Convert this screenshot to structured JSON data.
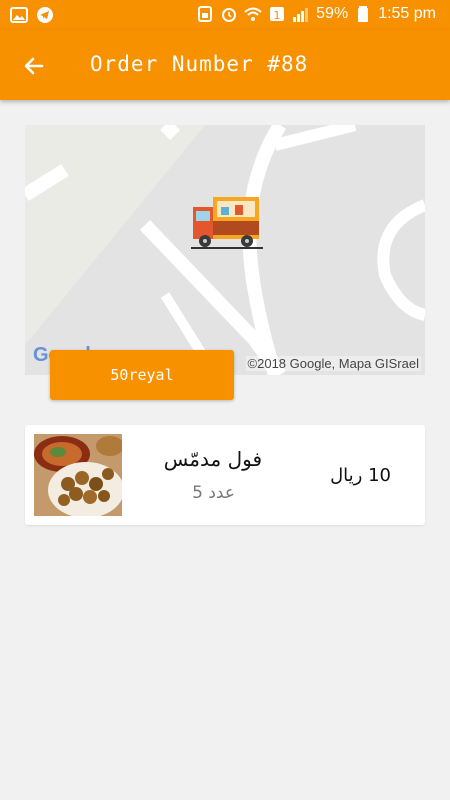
{
  "status_bar": {
    "battery_percent": "59%",
    "time": "1:55 pm",
    "icons": [
      "gallery-icon",
      "telegram-icon",
      "sim-icon",
      "alarm-icon",
      "wifi-icon",
      "notification-icon",
      "signal-icon",
      "battery-icon"
    ]
  },
  "app_bar": {
    "title": "Order Number #88",
    "back_icon": "arrow-left-icon"
  },
  "map": {
    "attribution": "©2018 Google, Mapa GISrael",
    "logo_text": "Google",
    "marker_icon": "food-truck-icon"
  },
  "price_button": {
    "label": "50reyal"
  },
  "order_items": [
    {
      "name": "فول مدمّس",
      "quantity": "عدد 5",
      "price": "10 ريال",
      "image_icon": "falafel-plate-image"
    }
  ],
  "colors": {
    "primary": "#f79100",
    "background": "#f1f1f1",
    "map": "#e3e3e3"
  }
}
